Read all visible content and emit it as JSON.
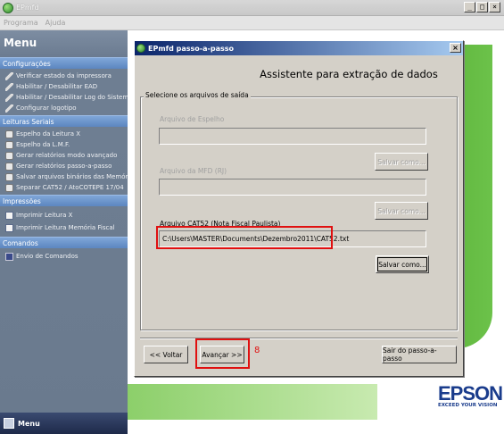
{
  "window": {
    "title": "EPmfd"
  },
  "menubar": {
    "items": [
      "Programa",
      "Ajuda"
    ]
  },
  "sidebar": {
    "title": "Menu",
    "footer": "Menu",
    "sections": [
      {
        "header": "Configurações",
        "items": [
          "Verificar estado da impressora",
          "Habilitar / Desabilitar EAD",
          "Habilitar / Desabilitar Log do Sistema",
          "Configurar logotipo"
        ]
      },
      {
        "header": "Leituras Seriais",
        "items": [
          "Espelho da Leitura X",
          "Espelho da L.M.F.",
          "Gerar relatórios modo avançado",
          "Gerar relatórios passo-a-passo",
          "Salvar arquivos binários das Memórias",
          "Separar CAT52 / AtoCOTEPE 17/04"
        ]
      },
      {
        "header": "Impressões",
        "items": [
          "Imprimir Leitura X",
          "Imprimir Leitura Memória Fiscal"
        ]
      },
      {
        "header": "Comandos",
        "items": [
          "Envio de Comandos"
        ]
      }
    ]
  },
  "dialog": {
    "title": "EPmfd passo-a-passo",
    "heading": "Assistente para extração de dados",
    "group_label": "Selecione os arquivos de saída",
    "field1_label": "Arquivo de Espelho",
    "field1_value": "",
    "field2_label": "Arquivo da MFD (RJ)",
    "field2_value": "",
    "field3_label": "Arquivo CAT52 (Nota Fiscal Paulista)",
    "field3_value": "C:\\Users\\MASTER\\Documents\\Dezembro2011\\CAT52.txt",
    "save_as": "Salvar como...",
    "back": "<< Voltar",
    "next": "Avançar >>",
    "exit": "Sair do passo-a-passo",
    "step_number": "8"
  },
  "brand": {
    "logo": "EPSON",
    "tagline": "EXCEED YOUR VISION"
  }
}
